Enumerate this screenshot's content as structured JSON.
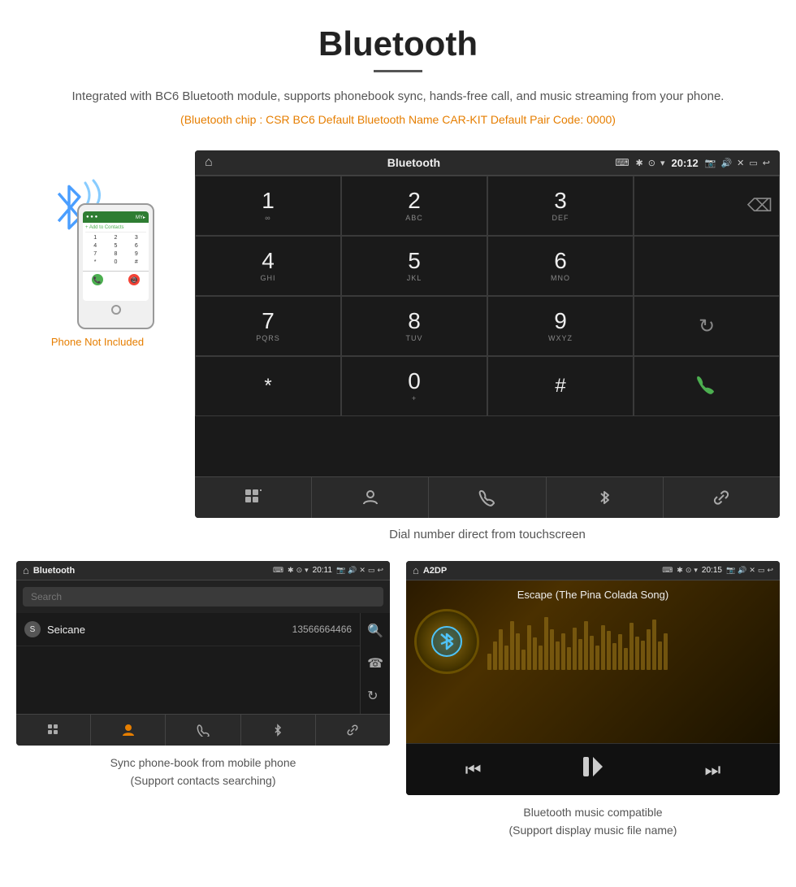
{
  "page": {
    "title": "Bluetooth",
    "description": "Integrated with BC6 Bluetooth module, supports phonebook sync, hands-free call, and music streaming from your phone.",
    "specs": "(Bluetooth chip : CSR BC6    Default Bluetooth Name CAR-KIT    Default Pair Code: 0000)",
    "screen_caption": "Dial number direct from touchscreen",
    "phone_not_included": "Phone Not Included"
  },
  "car_screen": {
    "status_bar": {
      "title": "Bluetooth",
      "time": "20:12",
      "usb_icon": "⌨",
      "bt_icon": "✱",
      "location_icon": "⊙",
      "wifi_icon": "▾",
      "camera_icon": "⬡",
      "volume_icon": "◁",
      "close_icon": "✕",
      "screen_icon": "▭",
      "back_icon": "↩"
    },
    "keypad": [
      {
        "digit": "1",
        "sub": "∞",
        "col": 1
      },
      {
        "digit": "2",
        "sub": "ABC",
        "col": 2
      },
      {
        "digit": "3",
        "sub": "DEF",
        "col": 3
      },
      {
        "digit": "4",
        "sub": "GHI",
        "col": 1
      },
      {
        "digit": "5",
        "sub": "JKL",
        "col": 2
      },
      {
        "digit": "6",
        "sub": "MNO",
        "col": 3
      },
      {
        "digit": "7",
        "sub": "PQRS",
        "col": 1
      },
      {
        "digit": "8",
        "sub": "TUV",
        "col": 2
      },
      {
        "digit": "9",
        "sub": "WXYZ",
        "col": 3
      },
      {
        "digit": "*",
        "sub": "",
        "col": 1
      },
      {
        "digit": "0",
        "sub": "+",
        "col": 2
      },
      {
        "digit": "#",
        "sub": "",
        "col": 3
      }
    ],
    "toolbar_items": [
      "⊞",
      "⚬",
      "☎",
      "✱",
      "⛓"
    ]
  },
  "phonebook_screen": {
    "status_bar": {
      "title": "Bluetooth",
      "time": "20:11"
    },
    "search_placeholder": "Search",
    "contacts": [
      {
        "letter": "S",
        "name": "Seicane",
        "number": "13566664466"
      }
    ],
    "toolbar_items": [
      "⊞",
      "👤",
      "☎",
      "✱",
      "⛓"
    ]
  },
  "music_screen": {
    "status_bar": {
      "title": "A2DP",
      "time": "20:15"
    },
    "song_title": "Escape (The Pina Colada Song)",
    "controls": [
      "⏮",
      "⏯",
      "⏭"
    ]
  },
  "bottom_captions": {
    "phonebook": "Sync phone-book from mobile phone\n(Support contacts searching)",
    "music": "Bluetooth music compatible\n(Support display music file name)"
  },
  "phone_keypad": [
    "1",
    "2",
    "3",
    "4",
    "5",
    "6",
    "*",
    "0",
    "#"
  ]
}
